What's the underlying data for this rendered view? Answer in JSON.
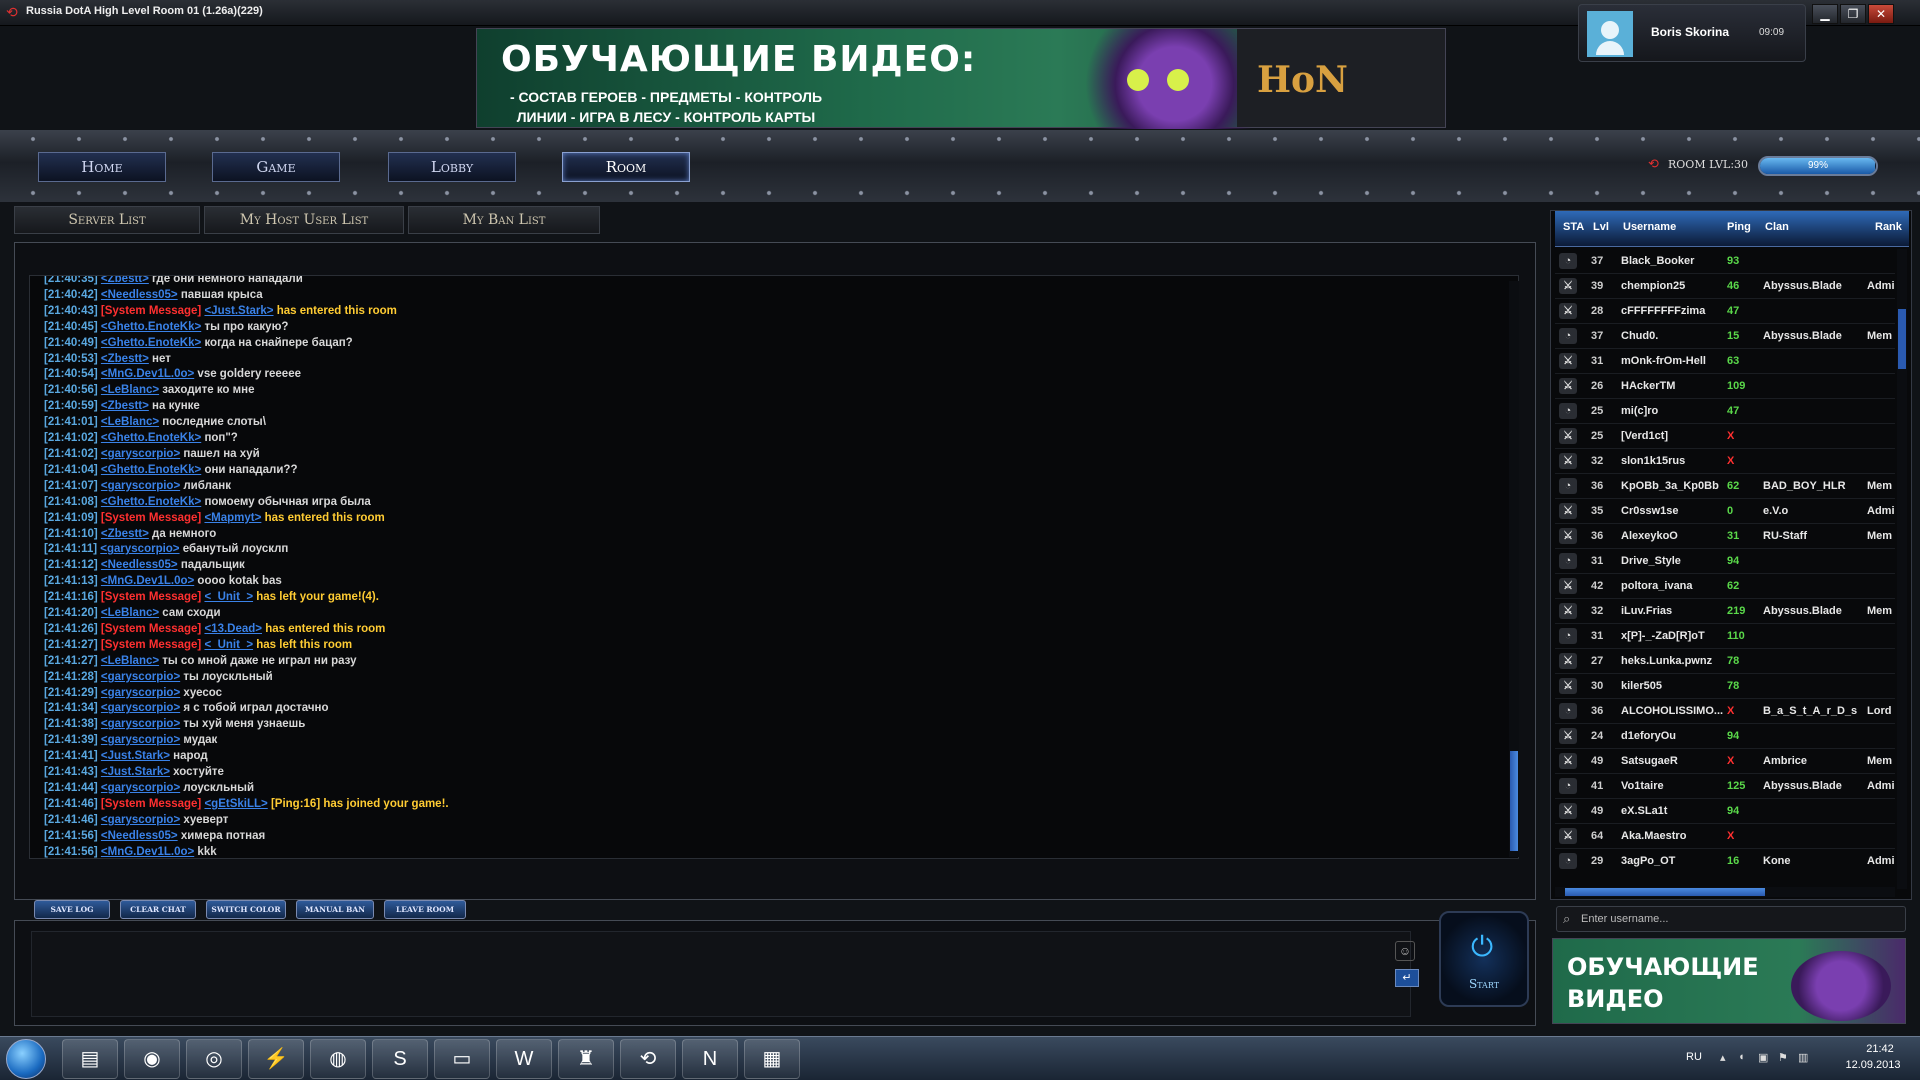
{
  "window": {
    "title": "Russia DotA High Level Room 01 (1.26a)(229)",
    "minimize": "▁",
    "restore": "❐",
    "close": "✕"
  },
  "banner": {
    "title": "ОБУЧАЮЩИЕ ВИДЕО:",
    "items": "- СОСТАВ ГЕРОЕВ - ПРЕДМЕТЫ - КОНТРОЛЬ ЛИНИИ - ИГРА В ЛЕСУ - КОНТРОЛЬ КАРТЫ",
    "logo": "HoN"
  },
  "user": {
    "name": "Boris Skorina",
    "time": "09:09"
  },
  "nav": {
    "tabs": [
      "Home",
      "Game",
      "Lobby",
      "Room"
    ],
    "room_level": "ROOM LVL:30",
    "progress_text": "99%",
    "progress": 0.99
  },
  "subtabs": [
    "Server List",
    "My Host User List",
    "My Ban List"
  ],
  "chat": [
    {
      "ts": "[21:40:35]",
      "nick": "<Zbestt>",
      "text": "где они немного нападали"
    },
    {
      "ts": "[21:40:42]",
      "nick": "<Needless05>",
      "text": "павшая крыса"
    },
    {
      "ts": "[21:40:43]",
      "sys": "[System Message]",
      "nick": "<Just.Stark>",
      "text": "has entered this room"
    },
    {
      "ts": "[21:40:45]",
      "nick": "<Ghetto.EnoteKk>",
      "text": "ты про какую?"
    },
    {
      "ts": "[21:40:49]",
      "nick": "<Ghetto.EnoteKk>",
      "text": "когда на снайпере бацап?"
    },
    {
      "ts": "[21:40:53]",
      "nick": "<Zbestt>",
      "text": "нет"
    },
    {
      "ts": "[21:40:54]",
      "nick": "<MnG.Dev1L.0o>",
      "text": "vse goldery reeeee"
    },
    {
      "ts": "[21:40:56]",
      "nick": "<LeBlanc>",
      "text": "заходите ко мне"
    },
    {
      "ts": "[21:40:59]",
      "nick": "<Zbestt>",
      "text": "на кунке"
    },
    {
      "ts": "[21:41:01]",
      "nick": "<LeBlanc>",
      "text": "последние слоты\\"
    },
    {
      "ts": "[21:41:02]",
      "nick": "<Ghetto.EnoteKk>",
      "text": "поп\"?"
    },
    {
      "ts": "[21:41:02]",
      "nick": "<garyscorpio>",
      "text": "пашел на хуй"
    },
    {
      "ts": "[21:41:04]",
      "nick": "<Ghetto.EnoteKk>",
      "text": "они нападали??"
    },
    {
      "ts": "[21:41:07]",
      "nick": "<garyscorpio>",
      "text": "либланк"
    },
    {
      "ts": "[21:41:08]",
      "nick": "<Ghetto.EnoteKk>",
      "text": "помоему обычная игра была"
    },
    {
      "ts": "[21:41:09]",
      "sys": "[System Message]",
      "nick": "<Mapmyt>",
      "text": "has entered this room"
    },
    {
      "ts": "[21:41:10]",
      "nick": "<Zbestt>",
      "text": "да немного"
    },
    {
      "ts": "[21:41:11]",
      "nick": "<garyscorpio>",
      "text": "ебанутый лоусклп"
    },
    {
      "ts": "[21:41:12]",
      "nick": "<Needless05>",
      "text": "падальщик"
    },
    {
      "ts": "[21:41:13]",
      "nick": "<MnG.Dev1L.0o>",
      "text": "oooo kotak bas"
    },
    {
      "ts": "[21:41:16]",
      "sys": "[System Message]",
      "nick": "<_Unit_>",
      "text": "has left your game!(4)."
    },
    {
      "ts": "[21:41:20]",
      "nick": "<LeBlanc>",
      "text": "сам сходи"
    },
    {
      "ts": "[21:41:26]",
      "sys": "[System Message]",
      "nick": "<13.Dead>",
      "text": "has entered this room"
    },
    {
      "ts": "[21:41:27]",
      "sys": "[System Message]",
      "nick": "<_Unit_>",
      "text": "has left this room"
    },
    {
      "ts": "[21:41:27]",
      "nick": "<LeBlanc>",
      "text": "ты со мной даже не играл ни разу"
    },
    {
      "ts": "[21:41:28]",
      "nick": "<garyscorpio>",
      "text": "ты лоускльный"
    },
    {
      "ts": "[21:41:29]",
      "nick": "<garyscorpio>",
      "text": "хуесос"
    },
    {
      "ts": "[21:41:34]",
      "nick": "<garyscorpio>",
      "text": "я с тобой играл достачно"
    },
    {
      "ts": "[21:41:38]",
      "nick": "<garyscorpio>",
      "text": "ты хуй меня узнаешь"
    },
    {
      "ts": "[21:41:39]",
      "nick": "<garyscorpio>",
      "text": "мудак"
    },
    {
      "ts": "[21:41:41]",
      "nick": "<Just.Stark>",
      "text": "народ"
    },
    {
      "ts": "[21:41:43]",
      "nick": "<Just.Stark>",
      "text": "хостуйте"
    },
    {
      "ts": "[21:41:44]",
      "nick": "<garyscorpio>",
      "text": "лоускльный"
    },
    {
      "ts": "[21:41:46]",
      "sys": "[System Message]",
      "nick": "<gEtSkiLL>",
      "ping": "[Ping:16]",
      "text": "has joined your game!."
    },
    {
      "ts": "[21:41:46]",
      "nick": "<garyscorpio>",
      "text": "хуеверт"
    },
    {
      "ts": "[21:41:56]",
      "nick": "<Needless05>",
      "text": "химера потная"
    },
    {
      "ts": "[21:41:56]",
      "nick": "<MnG.Dev1L.0o>",
      "text": "kkk"
    }
  ],
  "chat_buttons": [
    "SAVE LOG",
    "CLEAR CHAT",
    "SWITCH COLOR",
    "MANUAL BAN",
    "LEAVE ROOM"
  ],
  "start_label": "Start",
  "userlist": {
    "headers": {
      "sta": "STA",
      "lvl": "Lvl",
      "username": "Username",
      "ping": "Ping",
      "clan": "Clan",
      "rank": "Rank"
    },
    "rows": [
      {
        "lvl": "37",
        "name": "Black_Booker",
        "ping": "93",
        "clan": "",
        "rank": ""
      },
      {
        "lvl": "39",
        "name": "chempion25",
        "ping": "46",
        "clan": "Abyssus.Blade",
        "rank": "Admi"
      },
      {
        "lvl": "28",
        "name": "cFFFFFFFFzima",
        "ping": "47",
        "clan": "",
        "rank": ""
      },
      {
        "lvl": "37",
        "name": "Chud0.",
        "ping": "15",
        "clan": "Abyssus.Blade",
        "rank": "Mem"
      },
      {
        "lvl": "31",
        "name": "mOnk-frOm-Hell",
        "ping": "63",
        "clan": "",
        "rank": ""
      },
      {
        "lvl": "26",
        "name": "HAckerTM",
        "ping": "109",
        "clan": "",
        "rank": ""
      },
      {
        "lvl": "25",
        "name": "mi(c]ro",
        "ping": "47",
        "clan": "",
        "rank": ""
      },
      {
        "lvl": "25",
        "name": "[Verd1ct]",
        "ping": "X",
        "clan": "",
        "rank": ""
      },
      {
        "lvl": "32",
        "name": "slon1k15rus",
        "ping": "X",
        "clan": "",
        "rank": ""
      },
      {
        "lvl": "36",
        "name": "KpOBb_3a_Kp0Bb",
        "ping": "62",
        "clan": "BAD_BOY_HLR",
        "rank": "Mem"
      },
      {
        "lvl": "35",
        "name": "Cr0ssw1se",
        "ping": "0",
        "clan": "e.V.o",
        "rank": "Admi"
      },
      {
        "lvl": "36",
        "name": "AlexeykoO",
        "ping": "31",
        "clan": "RU-Staff",
        "rank": "Mem"
      },
      {
        "lvl": "31",
        "name": "Drive_Style",
        "ping": "94",
        "clan": "",
        "rank": ""
      },
      {
        "lvl": "42",
        "name": "poltora_ivana",
        "ping": "62",
        "clan": "",
        "rank": ""
      },
      {
        "lvl": "32",
        "name": "iLuv.Frias",
        "ping": "219",
        "clan": "Abyssus.Blade",
        "rank": "Mem"
      },
      {
        "lvl": "31",
        "name": "x[P]-_-ZaD[R]oT",
        "ping": "110",
        "clan": "",
        "rank": ""
      },
      {
        "lvl": "27",
        "name": "heks.Lunka.pwnz",
        "ping": "78",
        "clan": "",
        "rank": ""
      },
      {
        "lvl": "30",
        "name": "kiler505",
        "ping": "78",
        "clan": "",
        "rank": ""
      },
      {
        "lvl": "36",
        "name": "ALCOHOLISSIMO...",
        "ping": "X",
        "clan": "B_a_S_t_A_r_D_s",
        "rank": "Lord"
      },
      {
        "lvl": "24",
        "name": "d1eforyOu",
        "ping": "94",
        "clan": "",
        "rank": ""
      },
      {
        "lvl": "49",
        "name": "SatsugaeR",
        "ping": "X",
        "clan": "Ambrice",
        "rank": "Mem"
      },
      {
        "lvl": "41",
        "name": "Vo1taire",
        "ping": "125",
        "clan": "Abyssus.Blade",
        "rank": "Admi"
      },
      {
        "lvl": "49",
        "name": "eX.SLa1t",
        "ping": "94",
        "clan": "",
        "rank": ""
      },
      {
        "lvl": "64",
        "name": "Aka.Maestro",
        "ping": "X",
        "clan": "",
        "rank": ""
      },
      {
        "lvl": "29",
        "name": "3agPo_OT",
        "ping": "16",
        "clan": "Kone",
        "rank": "Admi"
      }
    ],
    "search_placeholder": "Enter username..."
  },
  "side_banner": {
    "title": "ОБУЧАЮЩИЕ ВИДЕО"
  },
  "taskbar": {
    "lang": "RU",
    "time": "21:42",
    "date": "12.09.2013"
  },
  "colors": {
    "accent": "#3a82e8",
    "system": "#ff3030",
    "system_text": "#ffcc33",
    "timestamp": "#5aa8e0"
  }
}
